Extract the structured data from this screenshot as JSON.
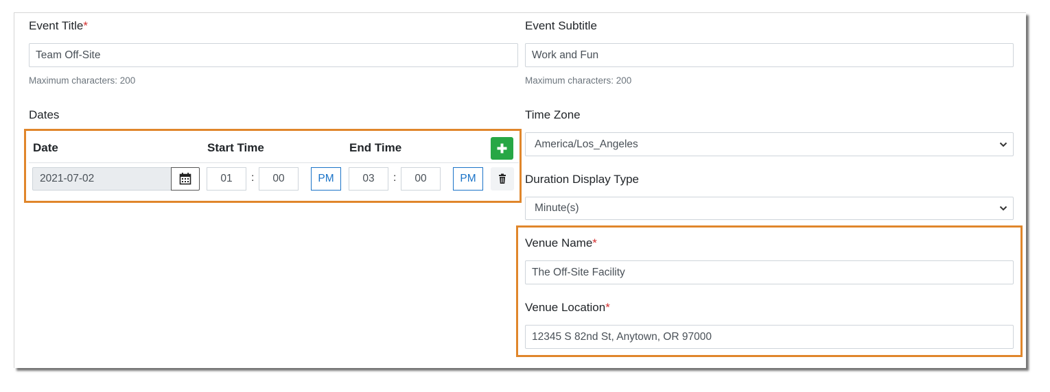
{
  "event_title": {
    "label": "Event Title",
    "required_mark": "*",
    "value": "Team Off-Site",
    "help": "Maximum characters: 200"
  },
  "event_subtitle": {
    "label": "Event Subtitle",
    "value": "Work and Fun",
    "help": "Maximum characters: 200"
  },
  "dates": {
    "section_label": "Dates",
    "headers": {
      "date": "Date",
      "start_time": "Start Time",
      "end_time": "End Time"
    },
    "add_icon": "plus-icon",
    "row": {
      "date": "2021-07-02",
      "calendar_icon": "calendar-icon",
      "start_hour": "01",
      "start_minute": "00",
      "start_ampm": "PM",
      "end_hour": "03",
      "end_minute": "00",
      "end_ampm": "PM",
      "separator": ":",
      "delete_icon": "trash-icon"
    }
  },
  "time_zone": {
    "label": "Time Zone",
    "value": "America/Los_Angeles"
  },
  "duration_display_type": {
    "label": "Duration Display Type",
    "value": "Minute(s)"
  },
  "venue_name": {
    "label": "Venue Name",
    "required_mark": "*",
    "value": "The Off-Site Facility"
  },
  "venue_location": {
    "label": "Venue Location",
    "required_mark": "*",
    "value": "12345 S 82nd St, Anytown, OR 97000"
  },
  "colors": {
    "highlight": "#e0862b",
    "add_button": "#28a745",
    "ampm_text": "#1a73c8",
    "required": "#d32f2f"
  }
}
